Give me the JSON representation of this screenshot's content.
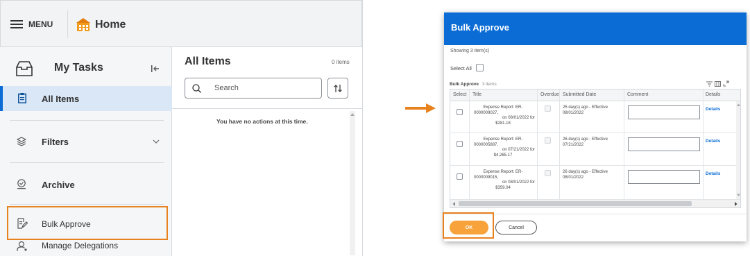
{
  "left": {
    "menu_label": "MENU",
    "home_label": "Home",
    "panel_title": "My Tasks",
    "nav": [
      {
        "label": "All Items"
      },
      {
        "label": "Filters"
      },
      {
        "label": "Archive"
      },
      {
        "label": "Bulk Approve"
      },
      {
        "label": "Manage Delegations"
      }
    ],
    "all_items_title": "All Items",
    "items_count": "0 items",
    "search_placeholder": "Search",
    "empty_message": "You have no actions at this time."
  },
  "dialog": {
    "title": "Bulk Approve",
    "showing": "Showing 3 item(s)",
    "select_all_label": "Select All",
    "section_label": "Bulk Approve",
    "section_count": "3 items",
    "columns": [
      "Select",
      "Title",
      "Overdue",
      "Submitted Date",
      "Comment",
      "Details"
    ],
    "rows": [
      {
        "title_line1": "Expense Report: ER-",
        "title_line2": "0000009027,",
        "title_line3": "on 08/01/2022 for",
        "title_line4": "$281.18",
        "submitted_line1": "25 day(s) ago - Effective",
        "submitted_line2": "08/01/2022",
        "details": "Details"
      },
      {
        "title_line1": "Expense Report: ER-",
        "title_line2": "0000005887,",
        "title_line3": "on 07/21/2022 for",
        "title_line4": "$4,265.17",
        "submitted_line1": "26 day(s) ago - Effective",
        "submitted_line2": "07/21/2022",
        "details": "Details"
      },
      {
        "title_line1": "Expense Report: ER-",
        "title_line2": "0000009015,",
        "title_line3": "on 08/01/2022 for",
        "title_line4": "$359.04",
        "submitted_line1": "26 day(s) ago - Effective",
        "submitted_line2": "08/01/2022",
        "details": "Details"
      }
    ],
    "ok_label": "OK",
    "cancel_label": "Cancel"
  },
  "colors": {
    "accent_orange": "#e8821e",
    "header_blue": "#0a6cd4",
    "ok_orange": "#f7a23a",
    "link_blue": "#0a6cd4"
  }
}
